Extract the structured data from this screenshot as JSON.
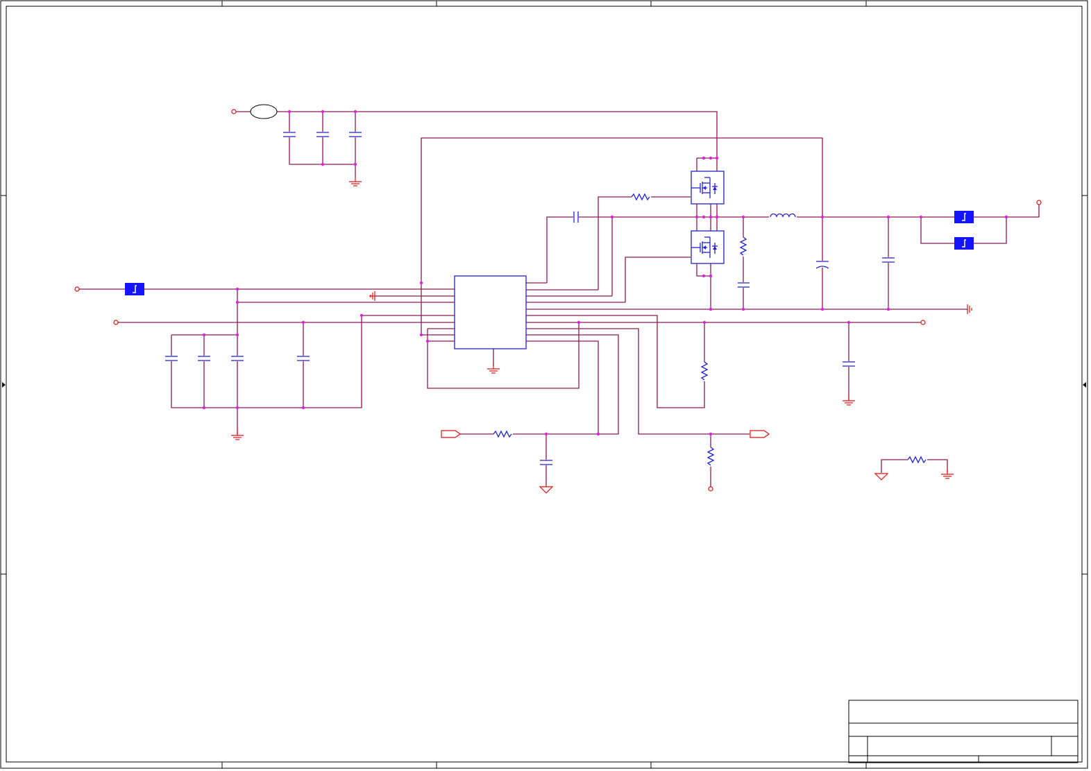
{
  "sheet": {
    "kind": "electronic schematic",
    "title_block": {
      "visible_text": []
    }
  },
  "colors": {
    "wire": "#8b1a4f",
    "component": "#1f1fd1",
    "junction": "#e020e0",
    "power_port": "#e01010",
    "pad_fill": "#1414ff",
    "frame": "#000000"
  },
  "icons": [
    "ground-symbol",
    "chassis-ground-symbol",
    "pad-symbol",
    "mosfet-symbol",
    "power-port-circle"
  ]
}
